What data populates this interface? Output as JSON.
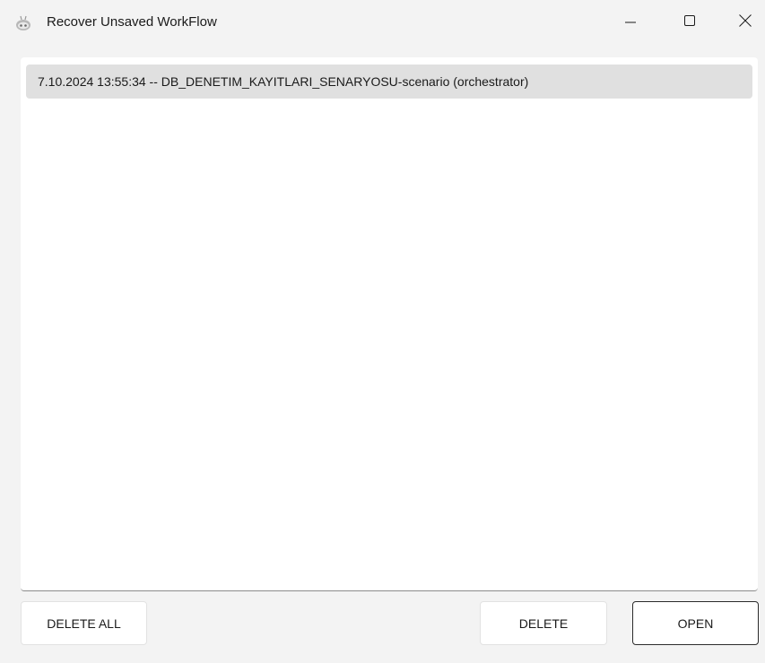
{
  "window": {
    "title": "Recover Unsaved WorkFlow",
    "app_icon": "robot-icon",
    "controls": {
      "minimize_icon": "minimize-icon",
      "maximize_icon": "maximize-icon",
      "close_icon": "close-icon"
    }
  },
  "recovery_list": {
    "items": [
      {
        "label": "7.10.2024 13:55:34 -- DB_DENETIM_KAYITLARI_SENARYOSU-scenario (orchestrator)",
        "selected": true
      }
    ]
  },
  "actions": {
    "delete_all_label": "DELETE ALL",
    "delete_label": "DELETE",
    "open_label": "OPEN"
  },
  "colors": {
    "background": "#f3f3f3",
    "panel": "#ffffff",
    "selected_item": "#e0e0e0",
    "default_button_border": "#2b2b2b"
  }
}
